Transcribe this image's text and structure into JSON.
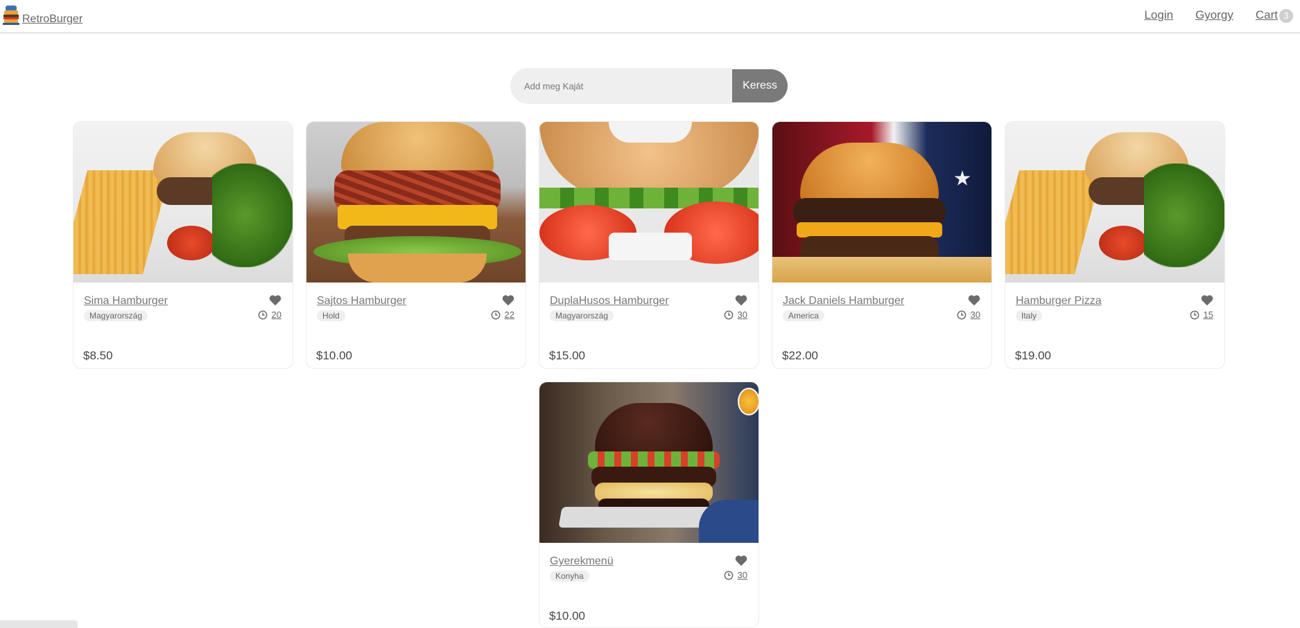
{
  "header": {
    "brand": "RetroBurger",
    "nav": {
      "login": "Login",
      "user": "Gyorgy",
      "cart": "Cart",
      "cart_count": "3"
    }
  },
  "search": {
    "placeholder": "Add meg Kaját",
    "button": "Keress"
  },
  "products": [
    {
      "name": "Sima Hamburger",
      "origin": "Magyarország",
      "time": "20",
      "price": "$8.50"
    },
    {
      "name": "Sajtos Hamburger",
      "origin": "Hold",
      "time": "22",
      "price": "$10.00"
    },
    {
      "name": "DuplaHusos Hamburger",
      "origin": "Magyarország",
      "time": "30",
      "price": "$15.00"
    },
    {
      "name": "Jack Daniels Hamburger",
      "origin": "America",
      "time": "30",
      "price": "$22.00"
    },
    {
      "name": "Hamburger Pizza",
      "origin": "Italy",
      "time": "15",
      "price": "$19.00"
    },
    {
      "name": "Gyerekmenü",
      "origin": "Konyha",
      "time": "30",
      "price": "$10.00"
    }
  ],
  "icons": {
    "favorite": "heart-icon",
    "time": "clock-icon",
    "logo": "burger-logo-icon"
  },
  "colors": {
    "accent": "#7a7a7a",
    "text": "#666666"
  }
}
